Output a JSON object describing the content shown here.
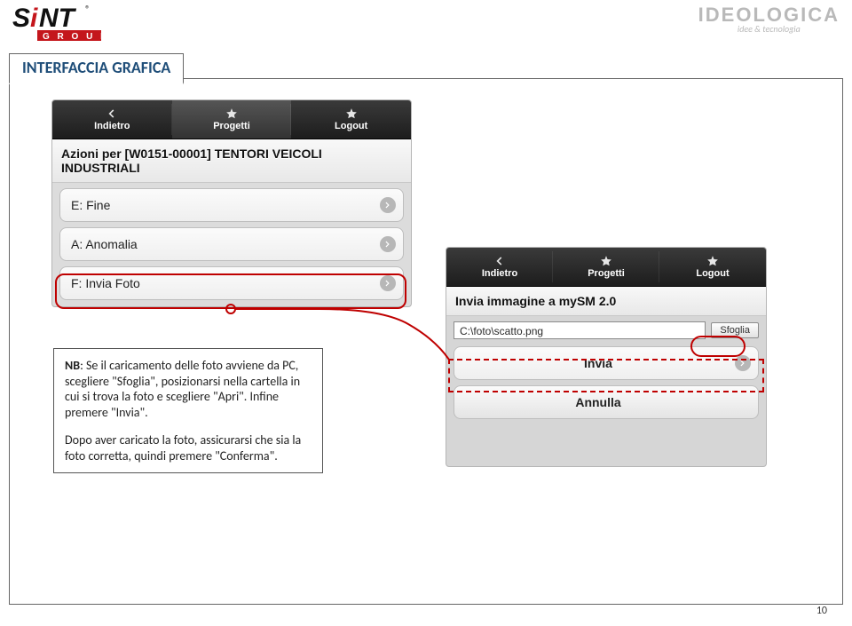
{
  "header": {
    "sint_main": "SiNT",
    "sint_reg": "®",
    "sint_sub": "G R O U P",
    "ideologica": "IDEOLOGICA",
    "ideologica_tag": "idee & tecnologia"
  },
  "tab_title": "INTERFACCIA GRAFICA",
  "page_number": "10",
  "left_phone": {
    "nav": {
      "back": "Indietro",
      "projects": "Progetti",
      "logout": "Logout"
    },
    "title": "Azioni per [W0151-00001] TENTORI VEICOLI INDUSTRIALI",
    "rows": {
      "e": "E: Fine",
      "a": "A: Anomalia",
      "f": "F: Invia Foto"
    }
  },
  "right_phone": {
    "nav": {
      "back": "Indietro",
      "projects": "Progetti",
      "logout": "Logout"
    },
    "title": "Invia immagine a mySM 2.0",
    "file_value": "C:\\foto\\scatto.png",
    "browse": "Sfoglia",
    "submit": "Invia",
    "cancel": "Annulla"
  },
  "nb": {
    "label": "NB",
    "p1": ": Se il caricamento delle foto avviene da PC, scegliere \"Sfoglia\", posizionarsi nella cartella in cui si trova la foto e scegliere \"Apri\". Infine premere \"Invia\".",
    "p2": "Dopo aver caricato la foto, assicurarsi che sia la foto corretta, quindi premere \"Conferma\"."
  }
}
